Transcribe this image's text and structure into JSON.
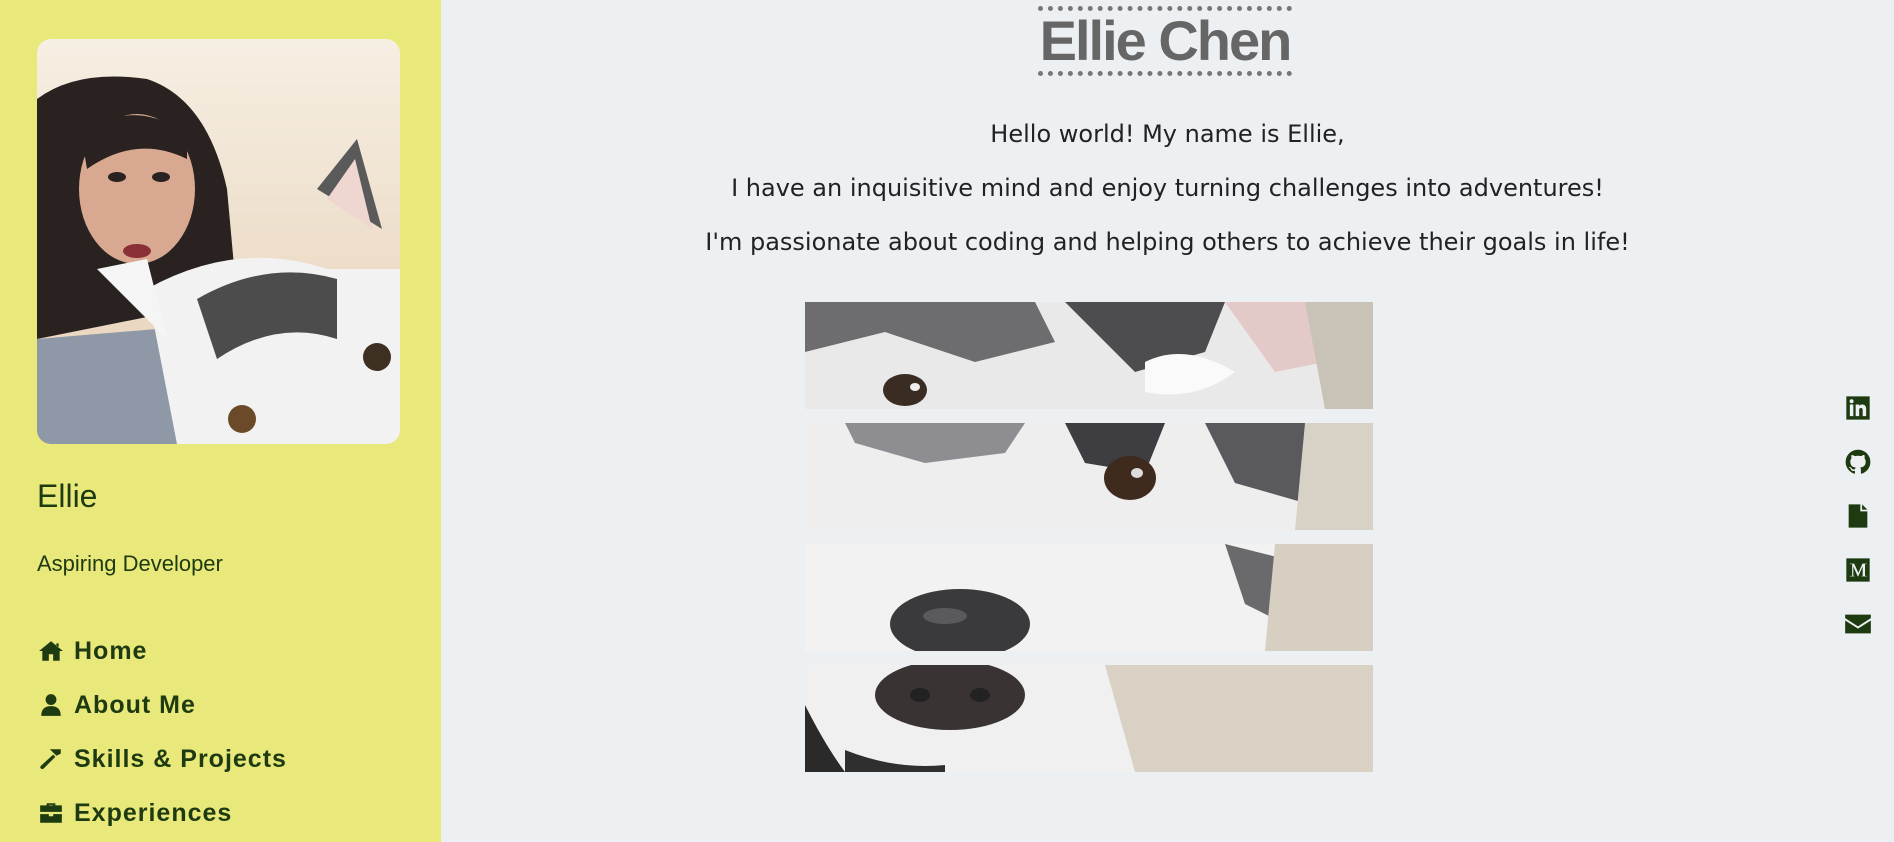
{
  "sidebar": {
    "profile": {
      "name": "Ellie",
      "role": "Aspiring Developer",
      "photo_icon": "profile-photo-with-husky"
    },
    "nav": [
      {
        "label": "Home",
        "icon": "home-icon"
      },
      {
        "label": "About Me",
        "icon": "user-icon"
      },
      {
        "label": "Skills & Projects",
        "icon": "hammer-icon"
      },
      {
        "label": "Experiences",
        "icon": "briefcase-icon"
      }
    ]
  },
  "main": {
    "title": "Ellie Chen",
    "intro": [
      "Hello world! My name is Ellie,",
      "I have an inquisitive mind and enjoy turning challenges into adventures!",
      "I'm passionate about coding and helping others to achieve their goals in life!"
    ],
    "image_strips_icon": "husky-photo-strips"
  },
  "social": [
    {
      "icon": "linkedin-icon"
    },
    {
      "icon": "github-icon"
    },
    {
      "icon": "file-icon"
    },
    {
      "icon": "medium-icon"
    },
    {
      "icon": "envelope-icon"
    }
  ],
  "colors": {
    "sidebar_bg": "#e9e87a",
    "page_bg": "#edf0f2",
    "sidebar_text": "#1d3a10",
    "title_text": "#666666"
  }
}
